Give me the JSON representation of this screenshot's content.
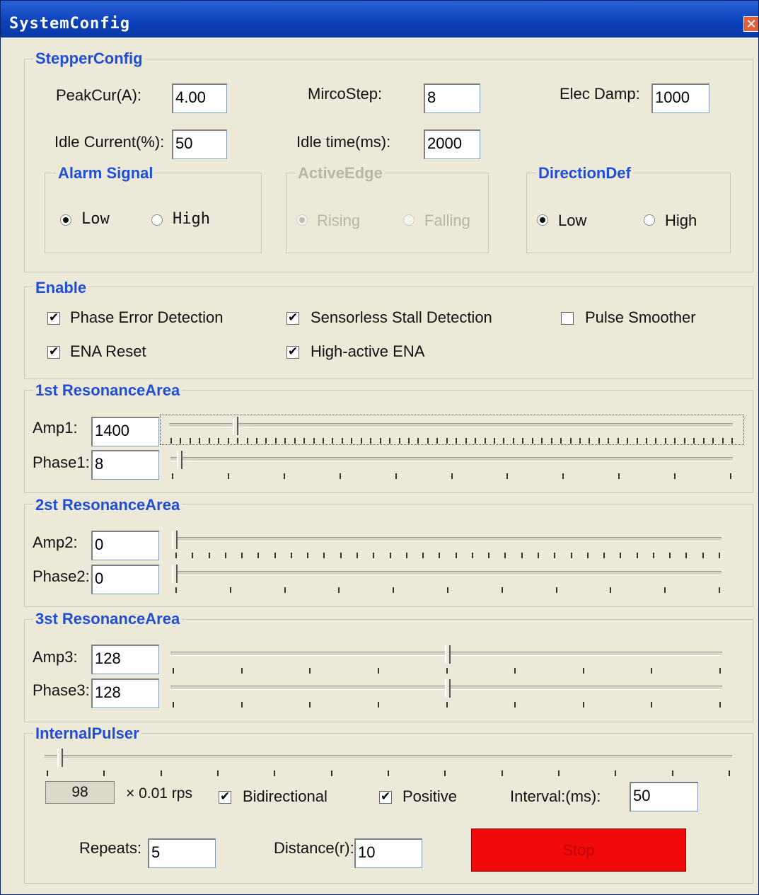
{
  "window": {
    "title": "SystemConfig",
    "close_glyph": "✕"
  },
  "stepper": {
    "group_title": "StepperConfig",
    "peak_cur_label": "PeakCur(A):",
    "peak_cur_value": "4.00",
    "microstep_label": "MircoStep:",
    "microstep_value": "8",
    "elec_damp_label": "Elec Damp:",
    "elec_damp_value": "1000",
    "idle_current_label": "Idle Current(%):",
    "idle_current_value": "50",
    "idle_time_label": "Idle time(ms):",
    "idle_time_value": "2000",
    "alarm": {
      "title": "Alarm Signal",
      "low": "Low",
      "high": "High",
      "selected": "Low"
    },
    "active_edge": {
      "title": "ActiveEdge",
      "rising": "Rising",
      "falling": "Falling",
      "selected": "Rising",
      "enabled": false
    },
    "direction": {
      "title": "DirectionDef",
      "low": "Low",
      "high": "High",
      "selected": "Low"
    }
  },
  "enable": {
    "group_title": "Enable",
    "phase_error": {
      "label": "Phase Error Detection",
      "checked": true
    },
    "sensorless_stall": {
      "label": "Sensorless Stall Detection",
      "checked": true
    },
    "pulse_smoother": {
      "label": "Pulse Smoother",
      "checked": false
    },
    "ena_reset": {
      "label": "ENA Reset",
      "checked": true
    },
    "high_active_ena": {
      "label": "High-active ENA",
      "checked": true
    }
  },
  "resonance1": {
    "title": "1st ResonanceArea",
    "amp_label": "Amp1:",
    "amp_value": "1400",
    "phase_label": "Phase1:",
    "phase_value": "8"
  },
  "resonance2": {
    "title": "2st ResonanceArea",
    "amp_label": "Amp2:",
    "amp_value": "0",
    "phase_label": "Phase2:",
    "phase_value": "0"
  },
  "resonance3": {
    "title": "3st ResonanceArea",
    "amp_label": "Amp3:",
    "amp_value": "128",
    "phase_label": "Phase3:",
    "phase_value": "128"
  },
  "pulser": {
    "title": "InternalPulser",
    "speed_value": "98",
    "speed_unit": "× 0.01 rps",
    "bidirectional": {
      "label": "Bidirectional",
      "checked": true
    },
    "positive": {
      "label": "Positive",
      "checked": true
    },
    "interval_label": "Interval:(ms):",
    "interval_value": "50",
    "repeats_label": "Repeats:",
    "repeats_value": "5",
    "distance_label": "Distance(r):",
    "distance_value": "10",
    "stop_label": "Stop"
  }
}
